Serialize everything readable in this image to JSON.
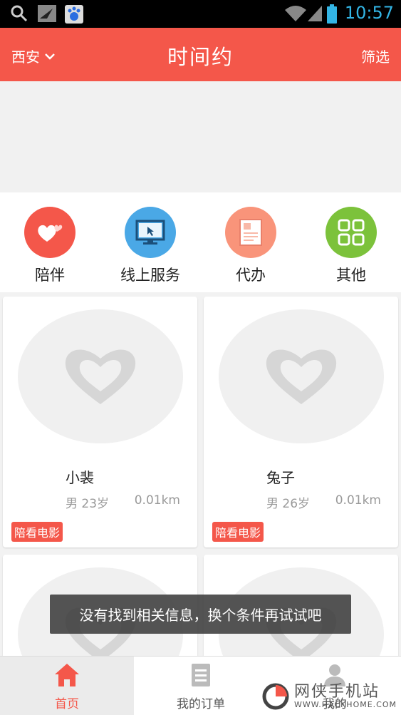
{
  "status_bar": {
    "time": "10:57"
  },
  "header": {
    "city": "西安",
    "title": "时间约",
    "filter_label": "筛选"
  },
  "categories": [
    {
      "label": "陪伴",
      "icon": "hearts-icon",
      "color": "#f4574a"
    },
    {
      "label": "线上服务",
      "icon": "monitor-icon",
      "color": "#4aa8e6"
    },
    {
      "label": "代办",
      "icon": "document-icon",
      "color": "#f9947a"
    },
    {
      "label": "其他",
      "icon": "grid-icon",
      "color": "#7cc23b"
    }
  ],
  "cards": [
    {
      "name": "小裴",
      "gender_age": "男 23岁",
      "distance": "0.01km",
      "tag": "陪看电影"
    },
    {
      "name": "兔子",
      "gender_age": "男 26岁",
      "distance": "0.01km",
      "tag": "陪看电影"
    },
    {
      "name": "",
      "gender_age": "",
      "distance": "",
      "tag": ""
    },
    {
      "name": "",
      "gender_age": "",
      "distance": "",
      "tag": ""
    }
  ],
  "toast": {
    "message": "没有找到相关信息，换个条件再试试吧"
  },
  "tabbar": [
    {
      "label": "首页",
      "icon": "home-icon",
      "active": true
    },
    {
      "label": "我的订单",
      "icon": "order-list-icon",
      "active": false
    },
    {
      "label": "我的",
      "icon": "profile-icon",
      "active": false
    }
  ],
  "watermark": {
    "text": "网侠手机站",
    "url_text": "WWW.HACKHOME.COM"
  },
  "colors": {
    "accent": "#f4574a",
    "status_blue": "#33b5e5"
  }
}
